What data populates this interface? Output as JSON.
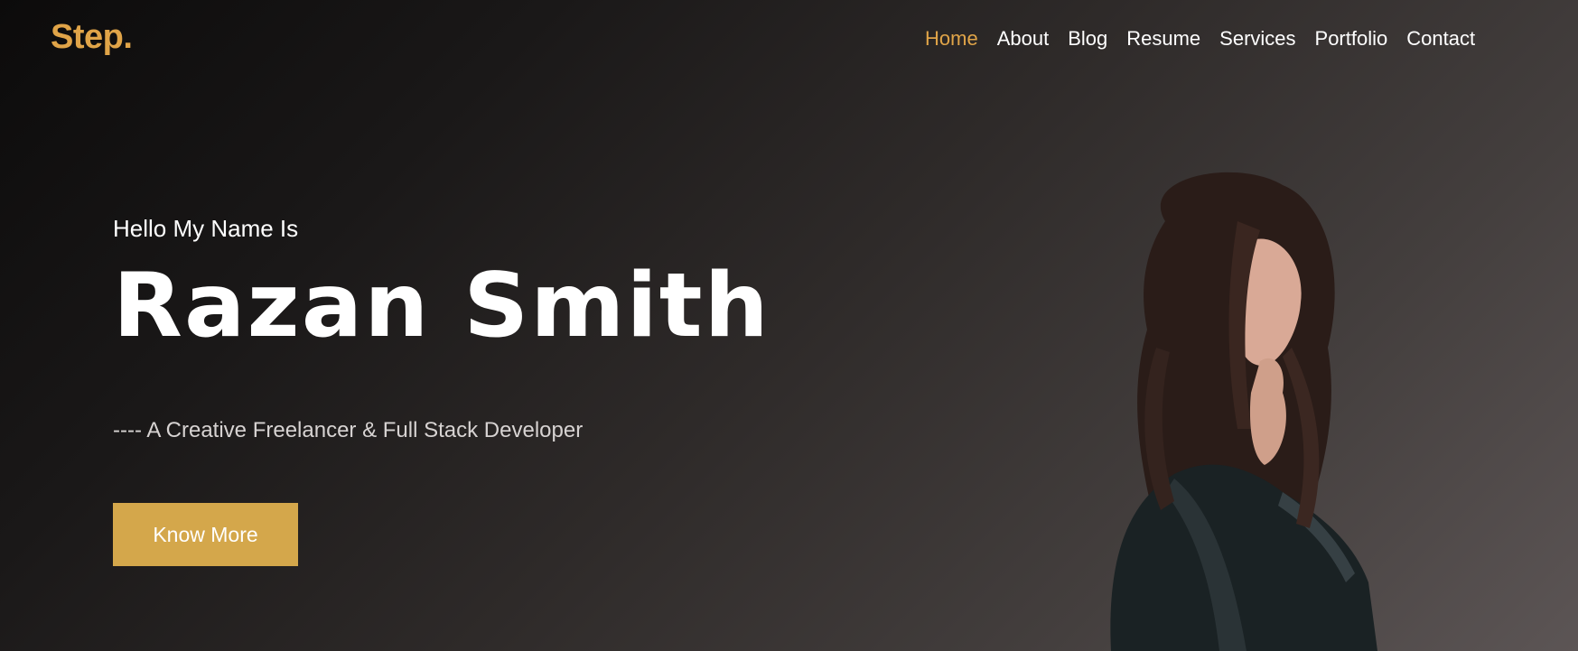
{
  "header": {
    "logo": "Step.",
    "nav": [
      "Home",
      "About",
      "Blog",
      "Resume",
      "Services",
      "Portfolio",
      "Contact"
    ],
    "active_nav": "Home"
  },
  "hero": {
    "greeting": "Hello My Name Is",
    "name": "Razan Smith",
    "tagline": "---- A Creative Freelancer & Full Stack Developer",
    "cta_label": "Know More"
  },
  "colors": {
    "accent": "#e0a448",
    "button": "#d4a74b",
    "text": "#ffffff"
  }
}
